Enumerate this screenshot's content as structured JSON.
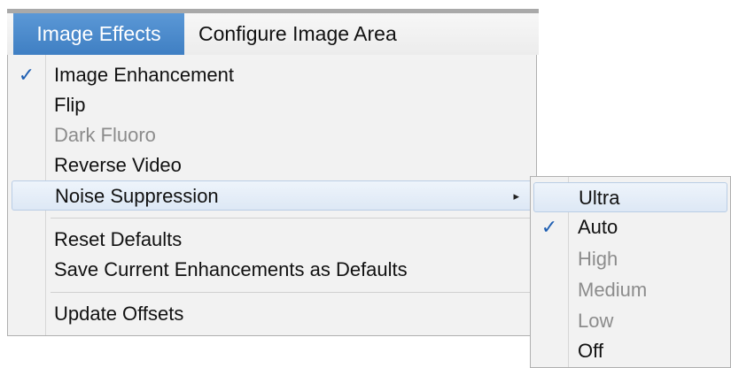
{
  "menubar": {
    "items": [
      {
        "label": "Image Effects"
      },
      {
        "label": "Configure Image Area"
      }
    ]
  },
  "menu": {
    "items": [
      {
        "label": "Image Enhancement",
        "checked": true
      },
      {
        "label": "Flip"
      },
      {
        "label": "Dark Fluoro",
        "disabled": true
      },
      {
        "label": "Reverse Video"
      },
      {
        "label": "Noise Suppression",
        "submenu": true
      },
      {
        "label": "Reset Defaults"
      },
      {
        "label": "Save Current Enhancements as Defaults"
      },
      {
        "label": "Update Offsets"
      }
    ],
    "check_glyph": "✓",
    "submenu_arrow": "▸"
  },
  "submenu": {
    "items": [
      {
        "label": "Ultra"
      },
      {
        "label": "Auto",
        "checked": true
      },
      {
        "label": "High",
        "disabled": true
      },
      {
        "label": "Medium",
        "disabled": true
      },
      {
        "label": "Low",
        "disabled": true
      },
      {
        "label": "Off"
      }
    ]
  },
  "colors": {
    "accent": "#3f7fc3",
    "check": "#1f5fb2",
    "disabled_text": "#8c8c8c"
  }
}
